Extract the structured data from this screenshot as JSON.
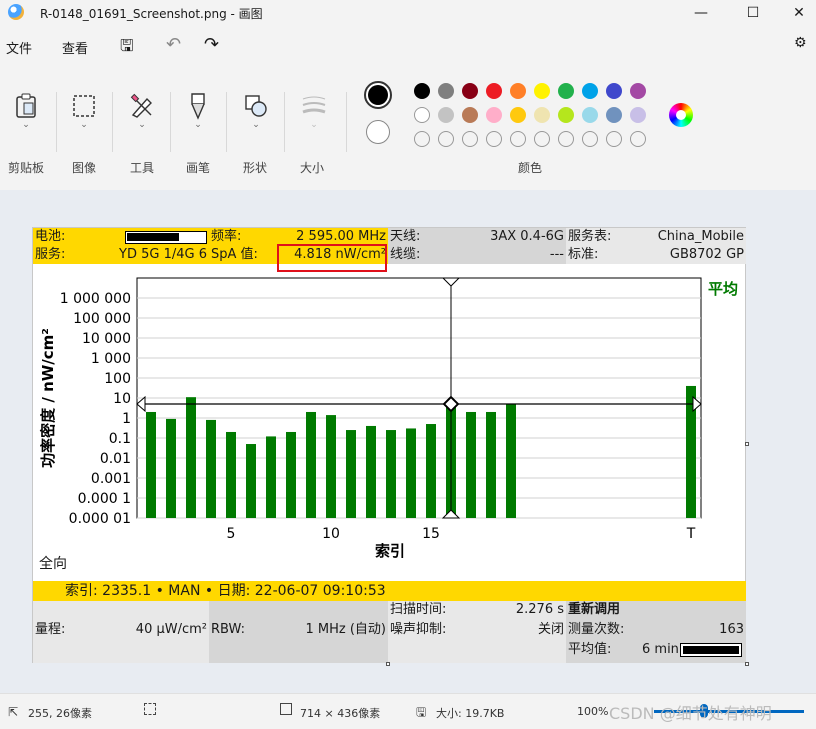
{
  "window": {
    "title": "R-0148_01691_Screenshot.png - 画图"
  },
  "menu": {
    "file": "文件",
    "view": "查看"
  },
  "ribbon": {
    "groups": {
      "clipboard": "剪贴板",
      "image": "图像",
      "tools": "工具",
      "brushes": "画笔",
      "shapes": "形状",
      "size": "大小",
      "colors": "颜色"
    }
  },
  "palette": {
    "row1": [
      "#000000",
      "#7f7f7f",
      "#880015",
      "#ed1c24",
      "#ff7f27",
      "#fff200",
      "#22b14c",
      "#00a2e8",
      "#3f48cc",
      "#a349a4"
    ],
    "row2": [
      "#ffffff",
      "#c3c3c3",
      "#b97a57",
      "#ffaec9",
      "#ffc90e",
      "#efe4b0",
      "#b5e61d",
      "#99d9ea",
      "#7092be",
      "#c8bfe7"
    ],
    "primary": "#000000",
    "secondary": "#ffffff"
  },
  "analyzer": {
    "header": {
      "battery_label": "电池:",
      "service_label": "服务:",
      "service_value": "YD 5G 1/4G 6",
      "freq_label": "频率:",
      "freq_value": "2 595.00 MHz",
      "spa_label": "SpA 值:",
      "spa_value": "4.818 nW/cm²",
      "antenna_label": "天线:",
      "antenna_value": "3AX 0.4-6G",
      "cable_label": "线缆:",
      "cable_value": "---",
      "service_table_label": "服务表:",
      "service_table_value": "China_Mobile",
      "standard_label": "标准:",
      "standard_value": "GB8702 GP"
    },
    "footer": {
      "omni": "全向",
      "info": "索引: 2335.1 • MAN • 日期: 22-06-07 09:10:53",
      "range_label": "量程:",
      "range_value": "40 µW/cm²",
      "rbw_label": "RBW:",
      "rbw_value": "1 MHz (自动)",
      "sweep_label": "扫描时间:",
      "sweep_value": "2.276 s",
      "noise_label": "噪声抑制:",
      "noise_value": "关闭",
      "recall_label": "重新调用",
      "count_label": "测量次数:",
      "count_value": "163",
      "avg_label": "平均值:",
      "avg_value": "6 min"
    }
  },
  "chart_data": {
    "type": "bar",
    "ylabel": "功率密度 / nW/cm²",
    "xlabel": "索引",
    "legend": "平均",
    "y_scale": "log",
    "ylim": [
      1e-05,
      10000000
    ],
    "y_ticks": [
      "1 000 000",
      "100 000",
      "10 000",
      "1 000",
      "100",
      "10",
      "1",
      "0.1",
      "0.01",
      "0.001",
      "0.000 1",
      "0.000 01"
    ],
    "y_tick_values": [
      1000000,
      100000,
      10000,
      1000,
      100,
      10,
      1,
      0.1,
      0.01,
      0.001,
      0.0001,
      1e-05
    ],
    "x_ticks": [
      "5",
      "10",
      "15",
      "T"
    ],
    "x_tick_positions": [
      5,
      10,
      15,
      28
    ],
    "x": [
      1,
      2,
      3,
      4,
      5,
      6,
      7,
      8,
      9,
      10,
      11,
      12,
      13,
      14,
      15,
      16,
      17,
      18,
      19,
      28
    ],
    "values": [
      2,
      0.9,
      11,
      0.8,
      0.2,
      0.05,
      0.12,
      0.2,
      2,
      1.4,
      0.25,
      0.4,
      0.25,
      0.3,
      0.5,
      5,
      2,
      2,
      5,
      40
    ],
    "cursor_x": 16,
    "threshold": 5,
    "color": "#007a00"
  },
  "status": {
    "cursor": "255, 26像素",
    "dimensions": "714 × 436像素",
    "size": "大小: 19.7KB",
    "zoom": "100%",
    "watermark": "CSDN @细节处有神明"
  }
}
